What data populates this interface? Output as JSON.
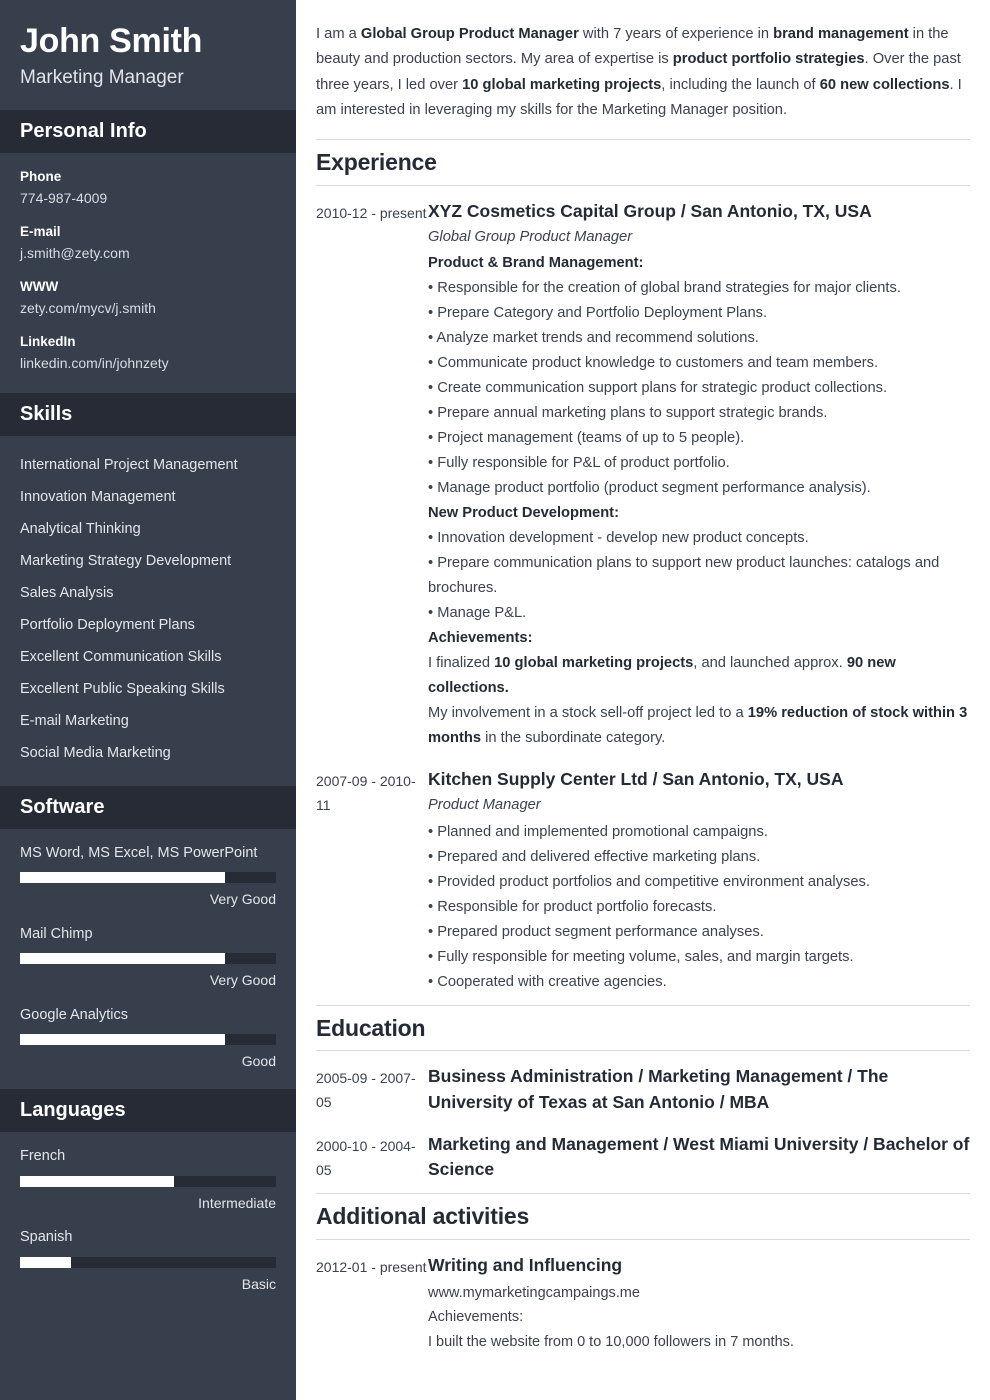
{
  "sidebar": {
    "name": "John Smith",
    "job_title": "Marketing Manager",
    "personal_info": {
      "heading": "Personal Info",
      "items": [
        {
          "label": "Phone",
          "value": "774-987-4009"
        },
        {
          "label": "E-mail",
          "value": "j.smith@zety.com"
        },
        {
          "label": "WWW",
          "value": "zety.com/mycv/j.smith"
        },
        {
          "label": "LinkedIn",
          "value": "linkedin.com/in/johnzety"
        }
      ]
    },
    "skills": {
      "heading": "Skills",
      "items": [
        "International Project Management",
        "Innovation Management",
        "Analytical Thinking",
        "Marketing Strategy Development",
        "Sales Analysis",
        "Portfolio Deployment Plans",
        "Excellent Communication Skills",
        "Excellent Public Speaking Skills",
        "E-mail Marketing",
        "Social Media Marketing"
      ]
    },
    "software": {
      "heading": "Software",
      "items": [
        {
          "name": "MS Word, MS Excel, MS PowerPoint",
          "level": "Very Good",
          "percent": 80
        },
        {
          "name": "Mail Chimp",
          "level": "Very Good",
          "percent": 80
        },
        {
          "name": "Google Analytics",
          "level": "Good",
          "percent": 80
        }
      ]
    },
    "languages": {
      "heading": "Languages",
      "items": [
        {
          "name": "French",
          "level": "Intermediate",
          "percent": 60
        },
        {
          "name": "Spanish",
          "level": "Basic",
          "percent": 20
        }
      ]
    }
  },
  "main": {
    "summary": {
      "parts": [
        {
          "t": "I am a ",
          "b": false
        },
        {
          "t": "Global Group Product Manager",
          "b": true
        },
        {
          "t": " with 7 years of experience in ",
          "b": false
        },
        {
          "t": "brand management",
          "b": true
        },
        {
          "t": " in the beauty and production sectors. My area of expertise is ",
          "b": false
        },
        {
          "t": "product portfolio strategies",
          "b": true
        },
        {
          "t": ". Over the past three years, I led over ",
          "b": false
        },
        {
          "t": "10 global marketing projects",
          "b": true
        },
        {
          "t": ", including the launch of ",
          "b": false
        },
        {
          "t": "60 new collections",
          "b": true
        },
        {
          "t": ". I am interested in leveraging my skills for the Marketing Manager position.",
          "b": false
        }
      ]
    },
    "experience": {
      "heading": "Experience",
      "entries": [
        {
          "date": "2010-12 - present",
          "org": "XYZ Cosmetics Capital Group / San Antonio, TX, USA",
          "role": "Global Group Product Manager",
          "blocks": [
            {
              "type": "subhead",
              "text": "Product & Brand Management:"
            },
            {
              "type": "bullet",
              "text": "• Responsible for the creation of global brand strategies for major clients."
            },
            {
              "type": "bullet",
              "text": "• Prepare Category and Portfolio Deployment Plans."
            },
            {
              "type": "bullet",
              "text": "• Analyze market trends and recommend solutions."
            },
            {
              "type": "bullet",
              "text": "• Communicate product knowledge to customers and team members."
            },
            {
              "type": "bullet",
              "text": "• Create communication support plans for strategic product collections."
            },
            {
              "type": "bullet",
              "text": "• Prepare annual marketing plans to support strategic brands."
            },
            {
              "type": "bullet",
              "text": "• Project management (teams of up to 5 people)."
            },
            {
              "type": "bullet",
              "text": "• Fully responsible for P&L of product portfolio."
            },
            {
              "type": "bullet",
              "text": "• Manage product portfolio (product segment performance analysis)."
            },
            {
              "type": "subhead",
              "text": "New Product Development:"
            },
            {
              "type": "bullet",
              "text": "• Innovation development - develop new product concepts."
            },
            {
              "type": "bullet",
              "text": "• Prepare communication plans to support new product launches: catalogs and brochures."
            },
            {
              "type": "bullet",
              "text": "• Manage P&L."
            },
            {
              "type": "subhead",
              "text": "Achievements:"
            },
            {
              "type": "rich",
              "parts": [
                {
                  "t": "I finalized ",
                  "b": false
                },
                {
                  "t": "10 global marketing projects",
                  "b": true
                },
                {
                  "t": ", and launched approx. ",
                  "b": false
                },
                {
                  "t": "90 new collections.",
                  "b": true
                }
              ]
            },
            {
              "type": "rich",
              "parts": [
                {
                  "t": "My involvement in a stock sell-off project led to a ",
                  "b": false
                },
                {
                  "t": "19% reduction of stock within 3 months",
                  "b": true
                },
                {
                  "t": " in the subordinate category.",
                  "b": false
                }
              ]
            }
          ]
        },
        {
          "date": "2007-09 - 2010-11",
          "org": "Kitchen Supply Center Ltd / San Antonio, TX, USA",
          "role": "Product Manager",
          "blocks": [
            {
              "type": "bullet",
              "text": "• Planned and implemented promotional campaigns."
            },
            {
              "type": "bullet",
              "text": "• Prepared and delivered effective marketing plans."
            },
            {
              "type": "bullet",
              "text": "• Provided product portfolios and competitive environment analyses."
            },
            {
              "type": "bullet",
              "text": "• Responsible for product portfolio forecasts."
            },
            {
              "type": "bullet",
              "text": "• Prepared product segment performance analyses."
            },
            {
              "type": "bullet",
              "text": "• Fully responsible for meeting volume, sales, and margin targets."
            },
            {
              "type": "bullet",
              "text": "• Cooperated with creative agencies."
            }
          ]
        }
      ]
    },
    "education": {
      "heading": "Education",
      "entries": [
        {
          "date": "2005-09 - 2007-05",
          "title": "Business Administration / Marketing Management / The University of Texas at San Antonio / MBA"
        },
        {
          "date": "2000-10 - 2004-05",
          "title": "Marketing and Management / West Miami University / Bachelor of Science"
        }
      ]
    },
    "additional": {
      "heading": "Additional activities",
      "entries": [
        {
          "date": "2012-01 - present",
          "title": "Writing and Influencing",
          "lines": [
            "www.mymarketingcampaings.me",
            "Achievements:",
            "I built the website from 0 to 10,000 followers in 7 months."
          ]
        }
      ]
    }
  }
}
